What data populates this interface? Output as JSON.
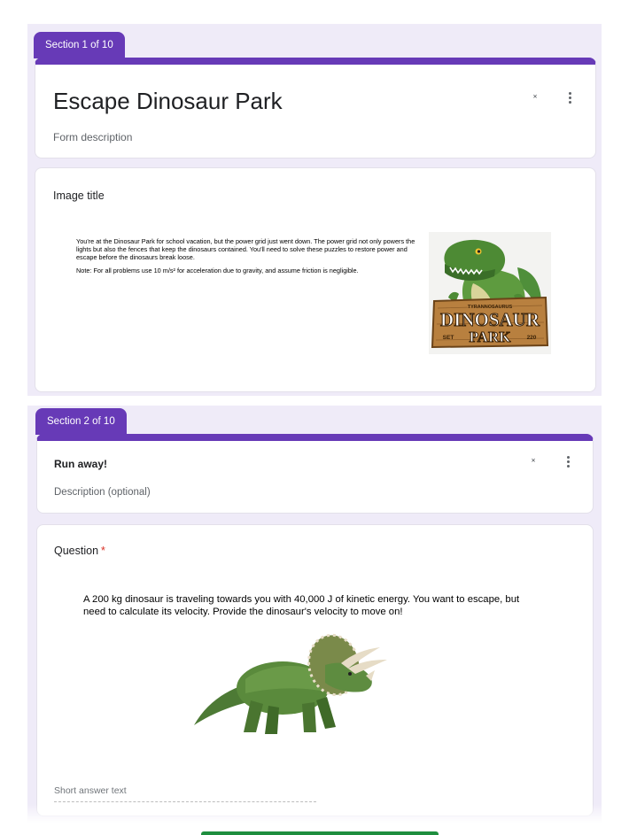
{
  "section1": {
    "tab_label": "Section 1 of 10",
    "form_title": "Escape Dinosaur Park",
    "form_description": "Form description",
    "image_item": {
      "title": "Image title",
      "story_p1": "You're at the Dinosaur Park for school vacation, but the power grid just went down. The power grid not only powers the lights but also the fences that keep the dinosaurs contained. You'll need to solve these puzzles to restore power and escape before the dinosaurs break loose.",
      "story_p2": "Note: For all problems use 10 m/s² for acceleration due to gravity, and assume friction is negligible.",
      "logo_small": "TYRANNOSAURUS",
      "logo_word1": "DINOSAUR",
      "logo_word2": "PARK",
      "logo_left": "SET",
      "logo_right": "220"
    }
  },
  "section2": {
    "tab_label": "Section 2 of 10",
    "title": "Run away!",
    "description": "Description (optional)",
    "question": {
      "label": "Question",
      "required_mark": "*",
      "text": "A 200 kg dinosaur is traveling towards you with 40,000 J of kinetic energy. You want to escape, but need to calculate its velocity. Provide the dinosaur's velocity to move on!",
      "answer_placeholder": "Short answer text"
    }
  },
  "icons": {
    "collapse": "collapse-icon",
    "more": "more-vert-icon",
    "trex": "trex-logo-image",
    "triceratops": "triceratops-image"
  },
  "colors": {
    "accent": "#673ab7",
    "background_panel": "#efebf8",
    "required": "#d93025",
    "bottom_bar": "#1e8e3e"
  }
}
